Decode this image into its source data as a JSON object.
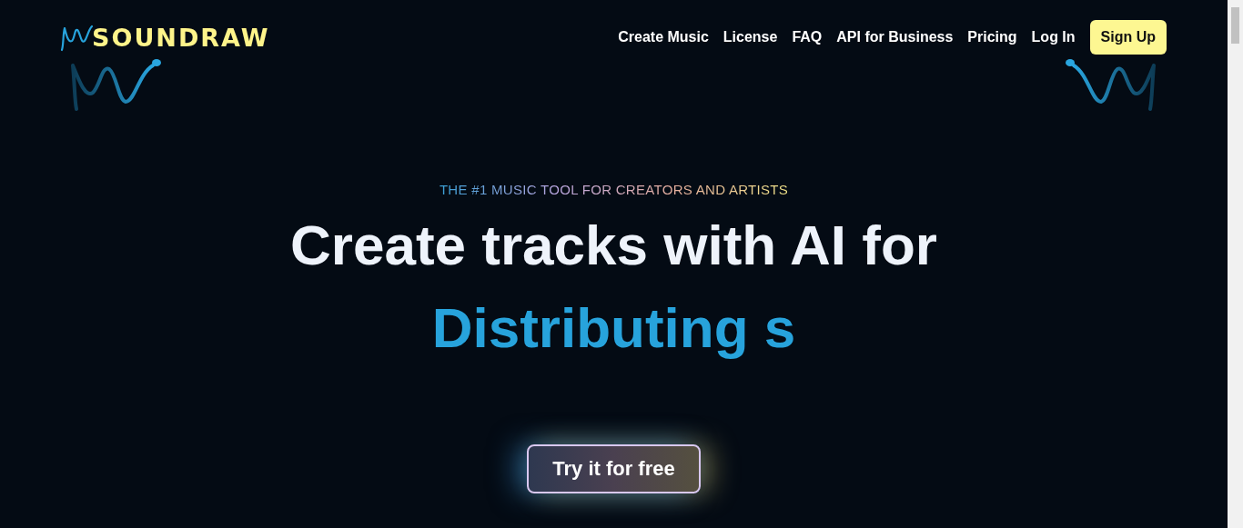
{
  "header": {
    "logo": "SOUNDRAW",
    "nav": [
      {
        "label": "Create Music"
      },
      {
        "label": "License"
      },
      {
        "label": "FAQ"
      },
      {
        "label": "API for Business"
      },
      {
        "label": "Pricing"
      },
      {
        "label": "Log In"
      }
    ],
    "signup": "Sign Up"
  },
  "hero": {
    "eyebrow": "THE #1 MUSIC TOOL FOR CREATORS AND ARTISTS",
    "title": "Create tracks with AI for",
    "highlight": "Distributing s",
    "cta": "Try it for free"
  }
}
